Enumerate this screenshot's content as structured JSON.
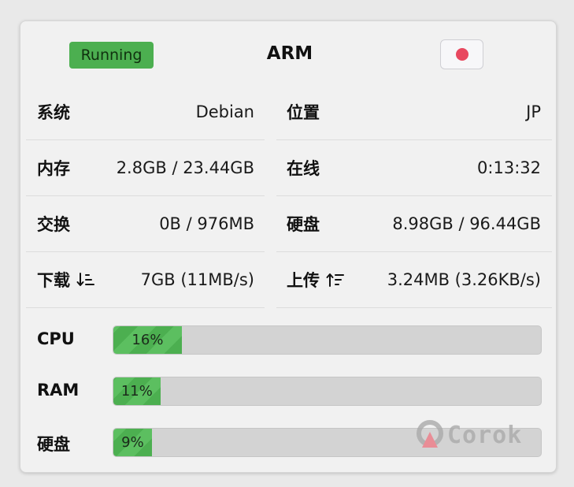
{
  "header": {
    "status": "Running",
    "title": "ARM"
  },
  "stats": {
    "left": [
      {
        "label": "系统",
        "value": "Debian"
      },
      {
        "label": "内存",
        "value": "2.8GB / 23.44GB"
      },
      {
        "label": "交换",
        "value": "0B / 976MB"
      },
      {
        "label": "下载",
        "value": "7GB (11MB/s)"
      }
    ],
    "right": [
      {
        "label": "位置",
        "value": "JP"
      },
      {
        "label": "在线",
        "value": "0:13:32"
      },
      {
        "label": "硬盘",
        "value": "8.98GB / 96.44GB"
      },
      {
        "label": "上传",
        "value": "3.24MB (3.26KB/s)"
      }
    ]
  },
  "bars": [
    {
      "label": "CPU",
      "percent_text": "16%",
      "percent": 16
    },
    {
      "label": "RAM",
      "percent_text": "11%",
      "percent": 11
    },
    {
      "label": "硬盘",
      "percent_text": "9%",
      "percent": 9
    }
  ],
  "watermark": {
    "text": "Corok"
  },
  "colors": {
    "accent_green": "#4caf50",
    "record_red": "#e8485f"
  },
  "icons": {
    "download": "sort-descending-icon",
    "upload": "sort-ascending-icon",
    "record": "record-dot-icon"
  }
}
